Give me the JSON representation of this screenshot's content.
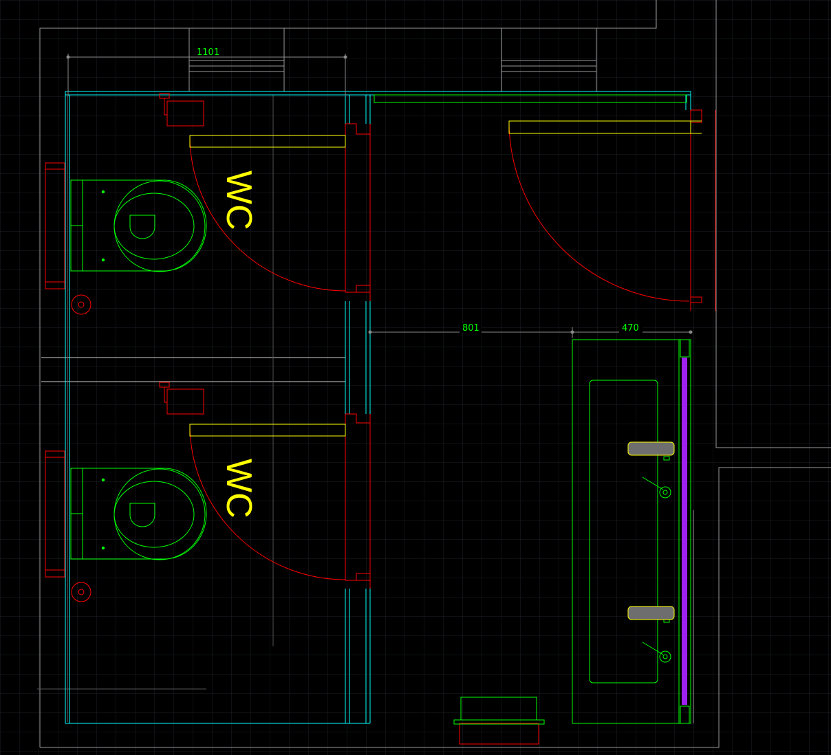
{
  "drawing": {
    "colors": {
      "background": "#000000",
      "grid": "#1e2228",
      "wall": "#9a9a9a",
      "partition": "#00ffff",
      "door": "#ff0000",
      "fixture": "#00ff00",
      "annotation": "#ffff00",
      "accent": "#a020f0",
      "fitting": "#6e6e6e"
    },
    "labels": {
      "room_upper": "WC",
      "room_lower": "WC"
    },
    "dimensions": {
      "top_width": "1101",
      "corridor_width": "801",
      "vanity_depth": "470"
    }
  }
}
